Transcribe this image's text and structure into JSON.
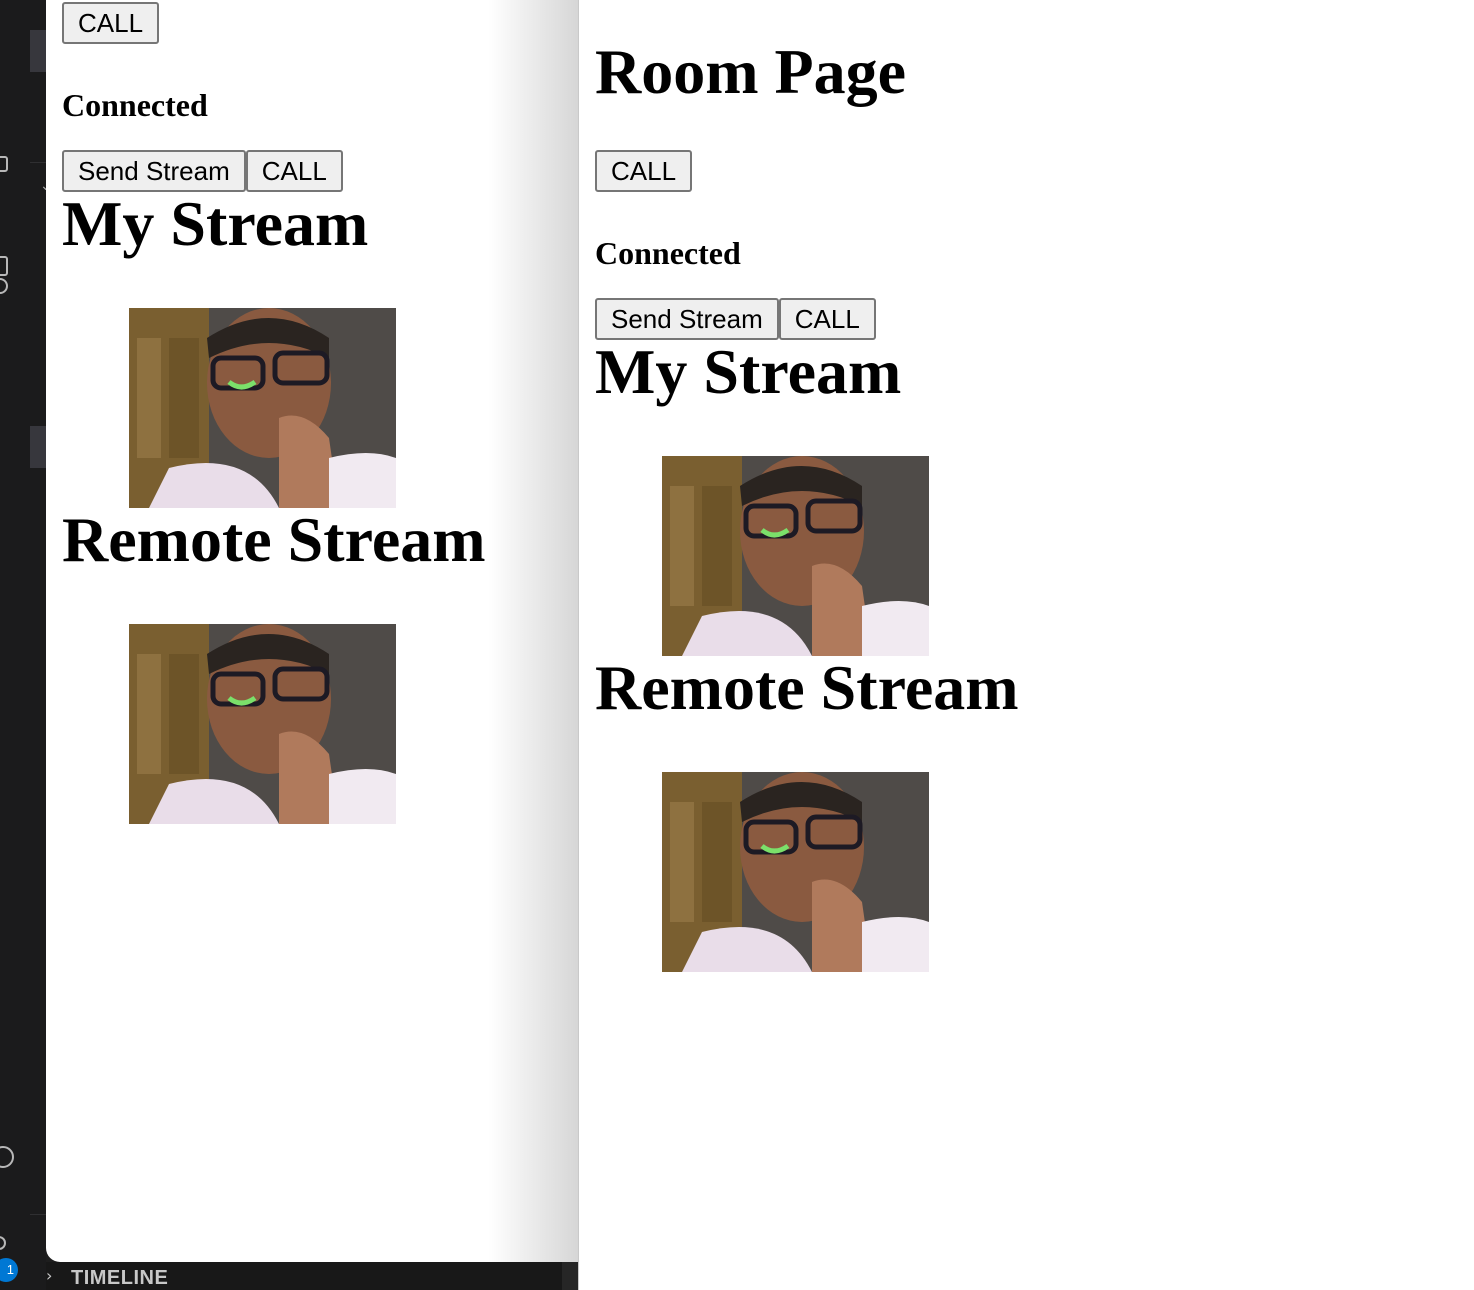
{
  "ide": {
    "badge": "1",
    "timeline_label": "TIMELINE",
    "chevron_icon": "chevron-right-icon"
  },
  "left_window": {
    "call_label": "CALL",
    "status": "Connected",
    "send_stream_label": "Send Stream",
    "call2_label": "CALL",
    "my_stream_heading": "My Stream",
    "remote_stream_heading": "Remote Stream"
  },
  "right_window": {
    "title": "Room Page",
    "call_label": "CALL",
    "status": "Connected",
    "send_stream_label": "Send Stream",
    "call2_label": "CALL",
    "my_stream_heading": "My Stream",
    "remote_stream_heading": "Remote Stream"
  },
  "colors": {
    "ide_background": "#1b1b1c",
    "page_background": "#ffffff",
    "button_background": "#efefef",
    "button_border": "#767676",
    "badge": "#0078d4"
  }
}
